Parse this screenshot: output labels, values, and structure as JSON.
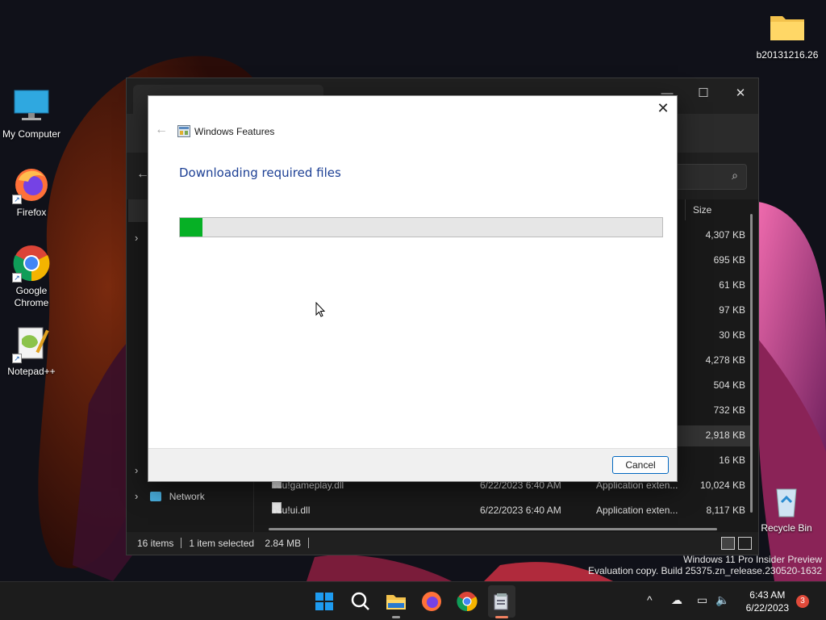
{
  "desktop": {
    "icons": [
      {
        "label": "My Computer",
        "icon": "monitor-icon"
      },
      {
        "label": "Firefox",
        "icon": "firefox-icon"
      },
      {
        "label": "Google Chrome",
        "icon": "chrome-icon"
      },
      {
        "label": "Notepad++",
        "icon": "notepadpp-icon"
      },
      {
        "label": "b20131216.26",
        "icon": "folder-icon"
      },
      {
        "label": "Recycle Bin",
        "icon": "recycle-bin-icon"
      }
    ]
  },
  "explorer": {
    "column_size_header": "Size",
    "sizes": [
      "4,307 KB",
      "695 KB",
      "61 KB",
      "97 KB",
      "30 KB",
      "4,278 KB",
      "504 KB",
      "732 KB",
      "2,918 KB",
      "16 KB",
      "10,024 KB",
      "8,117 KB"
    ],
    "visible_rows": [
      {
        "name": "osu!gameplay.dll",
        "date": "6/22/2023 6:40 AM",
        "type": "Application exten...",
        "size": "10,024 KB"
      },
      {
        "name": "osu!ui.dll",
        "date": "6/22/2023 6:40 AM",
        "type": "Application exten...",
        "size": "8,117 KB"
      }
    ],
    "nav": {
      "network_label": "Network"
    },
    "status": {
      "items": "16 items",
      "selected": "1 item selected",
      "selected_size": "2.84 MB"
    }
  },
  "dialog": {
    "title": "Windows Features",
    "heading": "Downloading required files",
    "progress": 0.047,
    "cancel_label": "Cancel",
    "close_glyph": "✕",
    "back_glyph": "←"
  },
  "watermark": {
    "line1": "Windows 11 Pro Insider Preview",
    "line2": "Evaluation copy. Build 25375.zn_release.230520-1632"
  },
  "taskbar": {
    "time": "6:43 AM",
    "date": "6/22/2023",
    "notifications": "3",
    "accent_color": "#0078d4"
  }
}
